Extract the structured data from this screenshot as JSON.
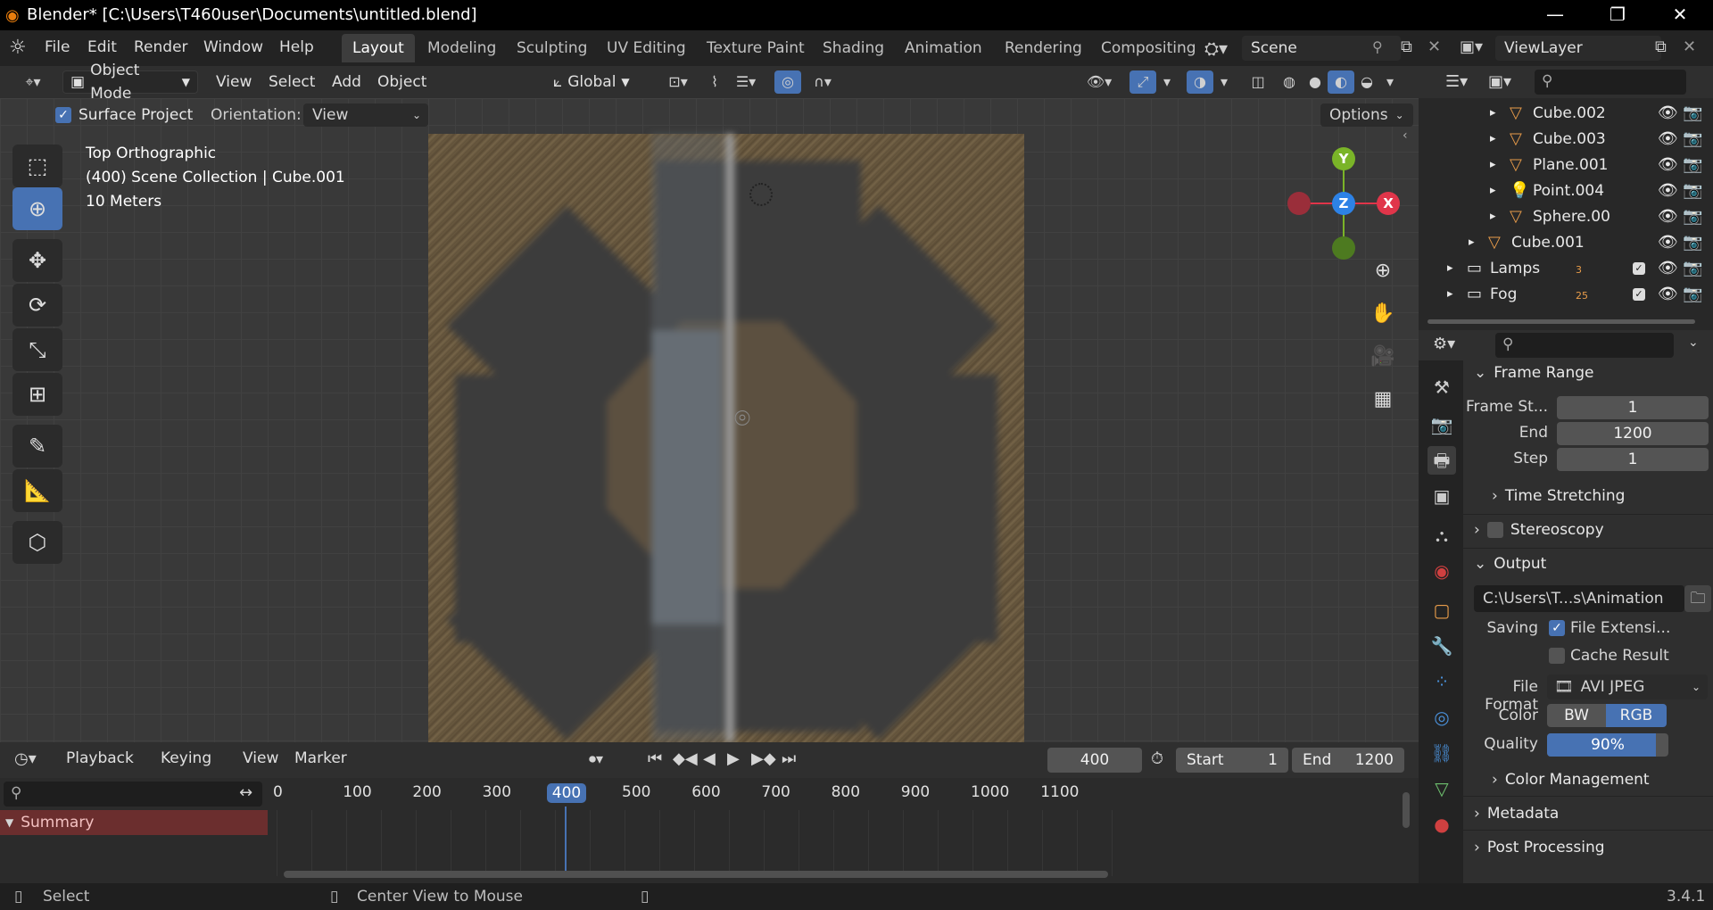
{
  "window": {
    "title": "Blender* [C:\\Users\\T460user\\Documents\\untitled.blend]",
    "minimize": "—",
    "restore": "❐",
    "close": "✕"
  },
  "menu": [
    "File",
    "Edit",
    "Render",
    "Window",
    "Help"
  ],
  "workspaces": [
    "Layout",
    "Modeling",
    "Sculpting",
    "UV Editing",
    "Texture Paint",
    "Shading",
    "Animation",
    "Rendering",
    "Compositing"
  ],
  "active_workspace": "Layout",
  "scene": {
    "name": "Scene",
    "view_layer": "ViewLayer"
  },
  "viewport_header": {
    "mode": "Object Mode",
    "menus": [
      "View",
      "Select",
      "Add",
      "Object"
    ],
    "orientation": "Global"
  },
  "tool_settings": {
    "surface_project": "Surface Project",
    "orientation_label": "Orientation:",
    "orientation_value": "View",
    "options": "Options"
  },
  "viewport_info": {
    "view_name": "Top Orthographic",
    "collection": "(400) Scene Collection | Cube.001",
    "scale": "10 Meters"
  },
  "gizmo": {
    "y": "Y",
    "z": "Z",
    "x": "X"
  },
  "outliner": {
    "rows": [
      {
        "name": "Cube.002",
        "indent": 2
      },
      {
        "name": "Cube.003",
        "indent": 2
      },
      {
        "name": "Plane.001",
        "indent": 2
      },
      {
        "name": "Point.004",
        "indent": 2
      },
      {
        "name": "Sphere.00",
        "indent": 2
      },
      {
        "name": "Cube.001",
        "indent": 1
      },
      {
        "name": "Lamps",
        "indent": 0,
        "badge": "3"
      },
      {
        "name": "Fog",
        "indent": 0,
        "badge": "25"
      }
    ]
  },
  "properties": {
    "frame_range": {
      "header": "Frame Range",
      "start_label": "Frame St...",
      "start_value": "1",
      "end_label": "End",
      "end_value": "1200",
      "step_label": "Step",
      "step_value": "1"
    },
    "time_stretching": "Time Stretching",
    "stereoscopy": "Stereoscopy",
    "output": {
      "header": "Output",
      "path": "C:\\Users\\T...s\\Animation",
      "saving_label": "Saving",
      "file_extensions": "File Extensi...",
      "cache_result": "Cache Result",
      "file_format_label": "File Format",
      "file_format_value": "AVI JPEG",
      "color_label": "Color",
      "color_bw": "BW",
      "color_rgb": "RGB",
      "quality_label": "Quality",
      "quality_value": "90%",
      "quality_fraction": 0.9
    },
    "color_management": "Color Management",
    "metadata": "Metadata",
    "post_processing": "Post Processing"
  },
  "timeline": {
    "menus": [
      "Playback",
      "Keying",
      "View",
      "Marker"
    ],
    "current_frame": "400",
    "start_label": "Start",
    "start_value": "1",
    "end_label": "End",
    "end_value": "1200",
    "ticks": [
      "0",
      "100",
      "200",
      "300",
      "400",
      "500",
      "600",
      "700",
      "800",
      "900",
      "1000",
      "1100"
    ],
    "summary": "Summary"
  },
  "statusbar": {
    "select": "Select",
    "center_view": "Center View to Mouse",
    "version": "3.4.1"
  },
  "colors": {
    "accent_blue": "#4772b3",
    "axis_x": "#e0354a",
    "axis_y": "#7ab428",
    "axis_z": "#2d82e6",
    "summary_bg": "#6b2e2e"
  }
}
